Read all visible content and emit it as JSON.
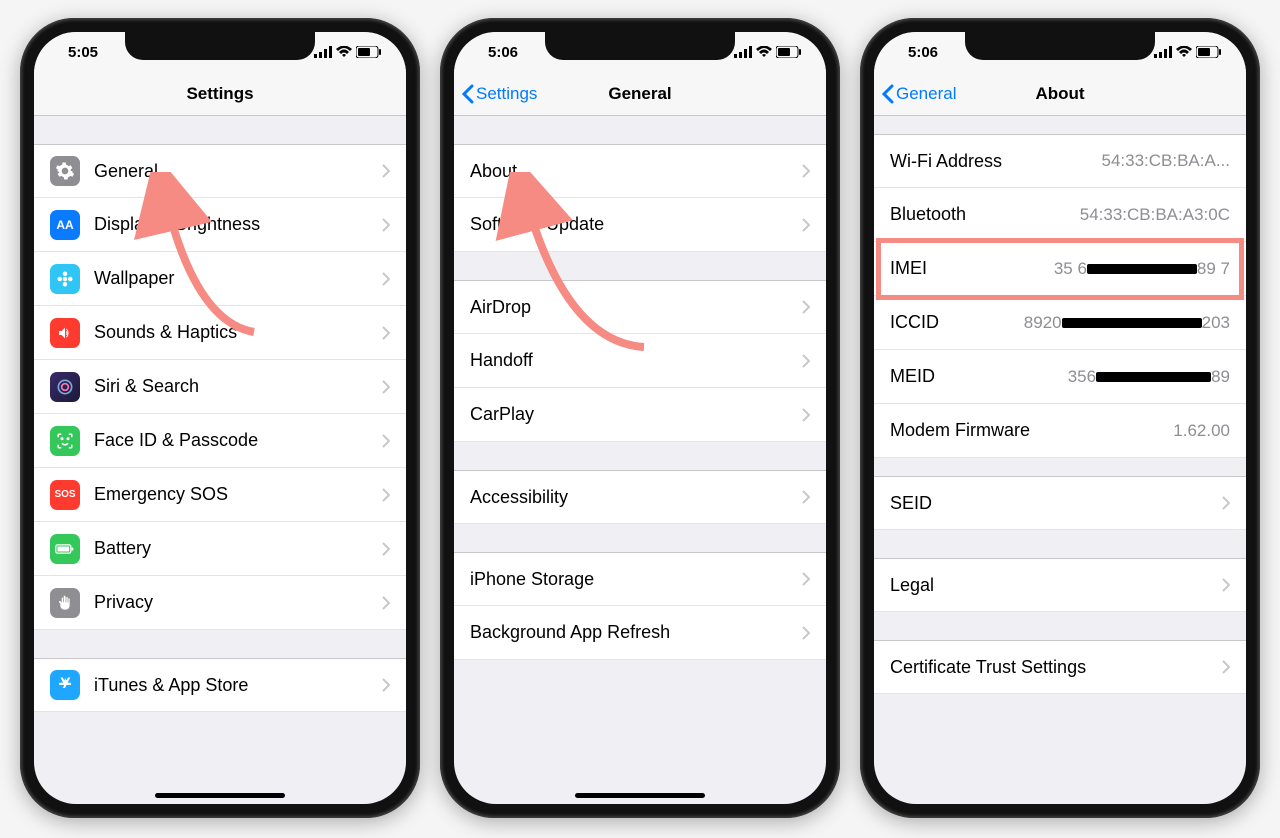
{
  "phone1": {
    "time": "5:05",
    "title": "Settings",
    "rows": [
      {
        "label": "General",
        "icon": "gear",
        "color": "#8e8e93"
      },
      {
        "label": "Display & Brightness",
        "icon": "AA",
        "color": "#0a7aff"
      },
      {
        "label": "Wallpaper",
        "icon": "flower",
        "color": "#2fc6f5"
      },
      {
        "label": "Sounds & Haptics",
        "icon": "speaker",
        "color": "#ff3b30"
      },
      {
        "label": "Siri & Search",
        "icon": "siri",
        "color": "#1a1a3a"
      },
      {
        "label": "Face ID & Passcode",
        "icon": "face",
        "color": "#34c759"
      },
      {
        "label": "Emergency SOS",
        "icon": "SOS",
        "color": "#ff3b30"
      },
      {
        "label": "Battery",
        "icon": "battery",
        "color": "#34c759"
      },
      {
        "label": "Privacy",
        "icon": "hand",
        "color": "#8e8e93"
      },
      {
        "label": "iTunes & App Store",
        "icon": "appstore",
        "color": "#1fa7ff"
      }
    ]
  },
  "phone2": {
    "time": "5:06",
    "back": "Settings",
    "title": "General",
    "groups": [
      [
        "About",
        "Software Update"
      ],
      [
        "AirDrop",
        "Handoff",
        "CarPlay"
      ],
      [
        "Accessibility"
      ],
      [
        "iPhone Storage",
        "Background App Refresh"
      ]
    ]
  },
  "phone3": {
    "time": "5:06",
    "back": "General",
    "title": "About",
    "rows": [
      {
        "label": "Wi-Fi Address",
        "value": "54:33:CB:BA:A...",
        "chevron": false
      },
      {
        "label": "Bluetooth",
        "value": "54:33:CB:BA:A3:0C",
        "chevron": false
      },
      {
        "label": "IMEI",
        "value_pre": "35 6",
        "value_post": "89 7",
        "redacted": true,
        "chevron": false
      },
      {
        "label": "ICCID",
        "value_pre": "8920",
        "value_post": "203",
        "redacted": true,
        "chevron": false
      },
      {
        "label": "MEID",
        "value_pre": "356",
        "value_post": "89",
        "redacted": true,
        "chevron": false
      },
      {
        "label": "Modem Firmware",
        "value": "1.62.00",
        "chevron": false
      },
      {
        "label": "SEID",
        "value": "",
        "chevron": true
      },
      {
        "label": "Legal",
        "value": "",
        "chevron": true
      },
      {
        "label": "Certificate Trust Settings",
        "value": "",
        "chevron": true
      }
    ]
  }
}
